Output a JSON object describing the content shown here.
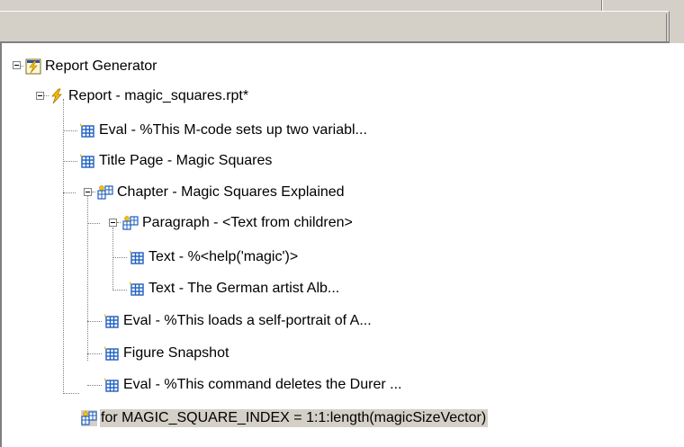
{
  "tree": {
    "root": {
      "label": "Report Generator",
      "icon": "report-generator-icon"
    },
    "report": {
      "label": "Report - magic_squares.rpt*",
      "icon": "lightning-icon"
    },
    "eval1": {
      "label": "Eval - %This M-code sets up two variabl...",
      "icon": "grid-icon"
    },
    "title_page": {
      "label": "Title Page - Magic Squares",
      "icon": "grid-icon"
    },
    "chapter": {
      "label": "Chapter - Magic Squares Explained",
      "icon": "grid-branch-icon"
    },
    "paragraph": {
      "label": "Paragraph - <Text from children>",
      "icon": "grid-branch-icon"
    },
    "text1": {
      "label": "Text - %<help('magic')>",
      "icon": "grid-icon"
    },
    "text2": {
      "label": "Text - The German artist Alb...",
      "icon": "grid-icon"
    },
    "eval2": {
      "label": "Eval - %This loads a self-portrait of A...",
      "icon": "grid-icon"
    },
    "figure": {
      "label": "Figure Snapshot",
      "icon": "grid-icon"
    },
    "eval3": {
      "label": "Eval - %This command deletes the Durer ...",
      "icon": "grid-icon"
    },
    "for_loop": {
      "label": "for MAGIC_SQUARE_INDEX = 1:1:length(magicSizeVector)",
      "icon": "grid-branch-icon",
      "selected": true
    }
  },
  "colors": {
    "chrome": "#d4d0c8",
    "tree_bg": "#ffffff",
    "tree_line": "#808080",
    "selection": "#d4d0c8",
    "grid_icon_blue": "#1f5fbf",
    "lightning_yellow": "#f2c200"
  }
}
